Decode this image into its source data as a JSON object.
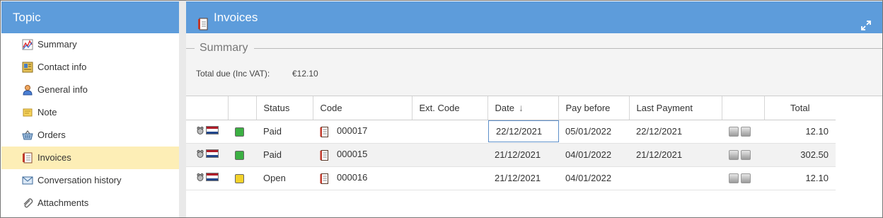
{
  "sidebar": {
    "title": "Topic",
    "items": [
      {
        "label": "Summary",
        "icon": "chart-icon",
        "active": false
      },
      {
        "label": "Contact info",
        "icon": "contact-card-icon",
        "active": false
      },
      {
        "label": "General info",
        "icon": "person-icon",
        "active": false
      },
      {
        "label": "Note",
        "icon": "note-icon",
        "active": false
      },
      {
        "label": "Orders",
        "icon": "basket-icon",
        "active": false
      },
      {
        "label": "Invoices",
        "icon": "invoice-icon",
        "active": true
      },
      {
        "label": "Conversation history",
        "icon": "envelope-icon",
        "active": false
      },
      {
        "label": "Attachments",
        "icon": "paperclip-icon",
        "active": false
      }
    ]
  },
  "main": {
    "title": "Invoices",
    "title_icon": "invoice-icon",
    "expand_icon": "expand-icon",
    "summary": {
      "legend": "Summary",
      "total_label": "Total due (Inc VAT):",
      "total_value": "€12.10"
    },
    "table": {
      "columns": [
        "",
        "",
        "Status",
        "Code",
        "Ext. Code",
        "Date",
        "Pay before",
        "Last Payment",
        "",
        "Total"
      ],
      "sort_column": "Date",
      "sort_indicator": "↓",
      "rows": [
        {
          "status": "Paid",
          "status_color": "#3cb043",
          "code": "000017",
          "ext_code": "",
          "date": "22/12/2021",
          "pay_before": "05/01/2022",
          "last_payment": "22/12/2021",
          "total": "12.10",
          "date_selected": true
        },
        {
          "status": "Paid",
          "status_color": "#3cb043",
          "code": "000015",
          "ext_code": "",
          "date": "21/12/2021",
          "pay_before": "04/01/2022",
          "last_payment": "21/12/2021",
          "total": "302.50",
          "date_selected": false
        },
        {
          "status": "Open",
          "status_color": "#f3d22b",
          "code": "000016",
          "ext_code": "",
          "date": "21/12/2021",
          "pay_before": "04/01/2022",
          "last_payment": "",
          "total": "12.10",
          "date_selected": false
        }
      ]
    }
  },
  "colors": {
    "header_blue": "#5d9cdb",
    "active_item": "#fdeeb6",
    "paid_green": "#3cb043",
    "open_yellow": "#f3d22b"
  }
}
